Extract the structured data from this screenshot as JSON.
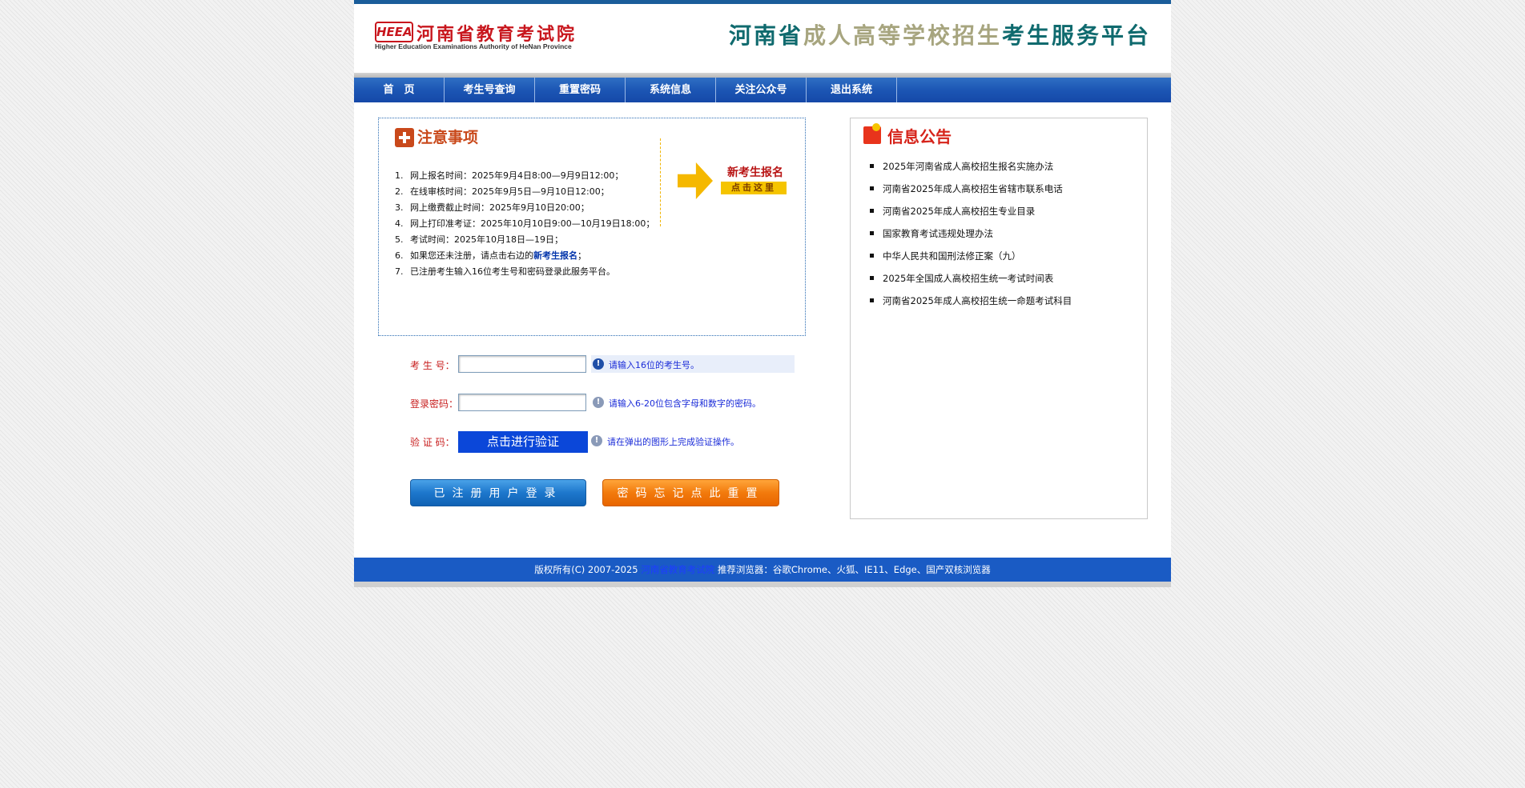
{
  "header": {
    "logo_badge": "HEEA",
    "logo_cn": "河南省教育考试院",
    "logo_en": "Higher Education Examinations Authority of HeNan Province",
    "title_part1": "河南省",
    "title_part2": "成人高等学校招生",
    "title_part3": "考生服务平台"
  },
  "nav": [
    "首　页",
    "考生号查询",
    "重置密码",
    "系统信息",
    "关注公众号",
    "退出系统"
  ],
  "notice": {
    "title": "注意事项",
    "items": [
      {
        "num": "1.",
        "text": "网上报名时间：2025年9月4日8:00—9月9日12:00；"
      },
      {
        "num": "2.",
        "text": "在线审核时间：2025年9月5日—9月10日12:00；"
      },
      {
        "num": "3.",
        "text": "网上缴费截止时间：2025年9月10日20:00；"
      },
      {
        "num": "4.",
        "text": "网上打印准考证：2025年10月10日9:00—10月19日18:00；"
      },
      {
        "num": "5.",
        "text": "考试时间：2025年10月18日—19日；"
      },
      {
        "num": "6.",
        "text_before": "如果您还未注册，请点击右边的",
        "highlight": "新考生报名",
        "text_after": "；"
      },
      {
        "num": "7.",
        "text": "已注册考生输入16位考生号和密码登录此服务平台。"
      }
    ],
    "register_title": "新考生报名",
    "register_sub": "点击这里"
  },
  "login": {
    "exam_no_label": "考 生 号：",
    "exam_no_value": "",
    "exam_no_hint": "请输入16位的考生号。",
    "password_label": "登录密码：",
    "password_value": "",
    "password_hint": "请输入6-20位包含字母和数字的密码。",
    "captcha_label": "验 证 码：",
    "captcha_button": "点击进行验证",
    "captcha_hint": "请在弹出的图形上完成验证操作。",
    "login_button": "已注册用户登录",
    "reset_button": "密码忘记点此重置"
  },
  "announcements": {
    "title": "信息公告",
    "items": [
      "2025年河南省成人高校招生报名实施办法",
      "河南省2025年成人高校招生省辖市联系电话",
      "河南省2025年成人高校招生专业目录",
      "国家教育考试违规处理办法",
      "中华人民共和国刑法修正案（九）",
      "2025年全国成人高校招生统一考试时间表",
      "河南省2025年成人高校招生统一命题考试科目"
    ]
  },
  "footer": {
    "copyright": "版权所有(C) 2007-2025",
    "org_link": "河南省教育考试院",
    "browsers": "推荐浏览器：谷歌Chrome、火狐、IE11、Edge、国产双核浏览器"
  },
  "colors": {
    "nav_blue": "#1c56b4",
    "footer_blue": "#1a5bc4",
    "accent_red": "#c8161d",
    "title_teal": "#0f6a6e",
    "title_khaki": "#a7a57f"
  }
}
